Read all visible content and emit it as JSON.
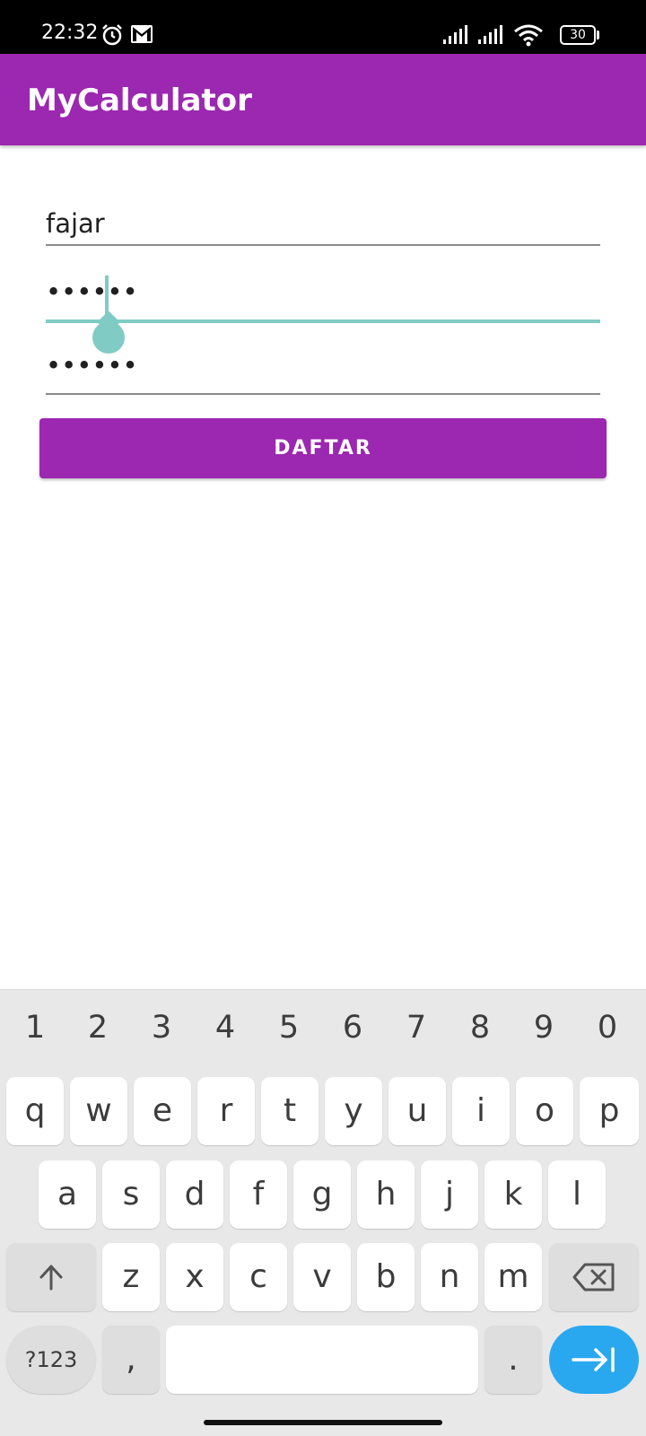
{
  "status_bar": {
    "time": "22:32",
    "battery": "30",
    "icons": [
      "alarm-icon",
      "gmail-icon",
      "signal-icon",
      "signal-icon",
      "wifi-icon",
      "battery-icon"
    ]
  },
  "app_bar": {
    "title": "MyCalculator"
  },
  "form": {
    "username_value": "fajar",
    "password_value": "••••••",
    "confirm_password_value": "••••••",
    "submit_label": "DAFTAR",
    "accent_color": "#9c27b0",
    "focus_color": "#80cbc4"
  },
  "keyboard": {
    "numbers": [
      "1",
      "2",
      "3",
      "4",
      "5",
      "6",
      "7",
      "8",
      "9",
      "0"
    ],
    "row1": [
      "q",
      "w",
      "e",
      "r",
      "t",
      "y",
      "u",
      "i",
      "o",
      "p"
    ],
    "row2": [
      "a",
      "s",
      "d",
      "f",
      "g",
      "h",
      "j",
      "k",
      "l"
    ],
    "row3": [
      "z",
      "x",
      "c",
      "v",
      "b",
      "n",
      "m"
    ],
    "symbols_label": "?123",
    "comma_label": ",",
    "period_label": "."
  }
}
